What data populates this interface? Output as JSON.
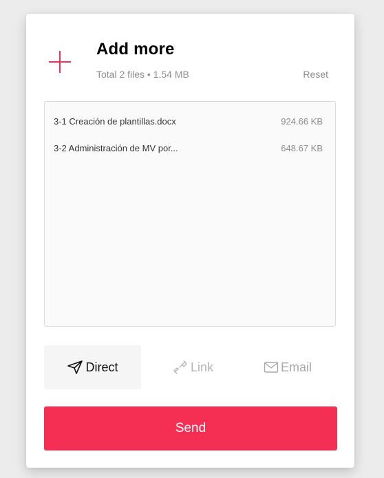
{
  "header": {
    "title": "Add more",
    "summary": "Total 2 files • 1.54 MB",
    "reset_label": "Reset",
    "add_icon": "plus-icon",
    "accent_color": "#f52e53"
  },
  "files": [
    {
      "name": "3-1 Creación de plantillas.docx",
      "size": "924.66 KB"
    },
    {
      "name": "3-2 Administración de MV por...",
      "size": "648.67 KB"
    }
  ],
  "transfer_modes": {
    "selected": "Direct",
    "items": [
      {
        "label": "Direct",
        "icon": "paper-plane-icon"
      },
      {
        "label": "Link",
        "icon": "link-icon"
      },
      {
        "label": "Email",
        "icon": "envelope-icon"
      }
    ]
  },
  "send_button": {
    "label": "Send",
    "color": "#f52e53"
  }
}
